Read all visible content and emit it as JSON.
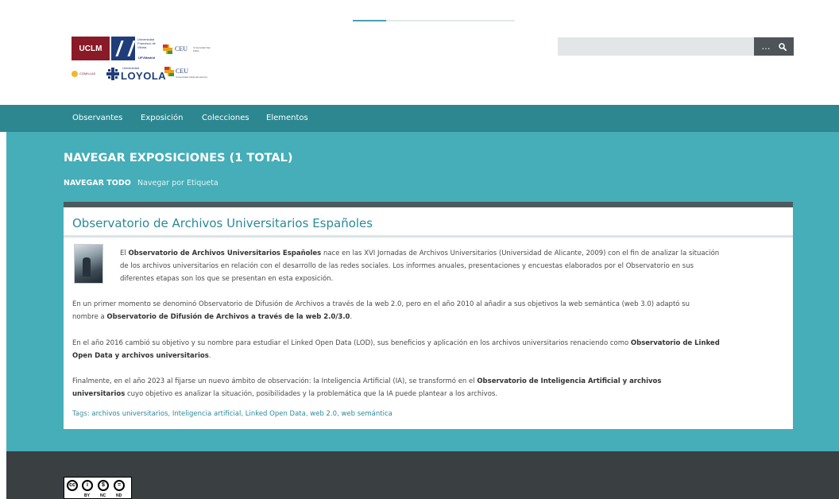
{
  "header": {
    "logos": {
      "uclm": "UCLM",
      "ufv_text": "Universidad Francisco de Vitoria",
      "ufv_madrid": "UFVMadrid",
      "ceu1": "CEU",
      "ceu1_small": "Universidad San Pablo",
      "comillas": "COMILLAS",
      "loyola_small": "Universidad",
      "loyola": "LOYOLA",
      "ceu2": "CEU",
      "ceu2_small": "Universidad Cardenal Herrera"
    },
    "search": {
      "value": "",
      "placeholder": "",
      "advanced_label": "…",
      "submit_icon": "search-icon"
    }
  },
  "nav": {
    "items": [
      "Observantes",
      "Exposición",
      "Colecciones",
      "Elementos"
    ]
  },
  "page": {
    "title": "NAVEGAR EXPOSICIONES (1 TOTAL)",
    "subnav_active": "NAVEGAR TODO",
    "subnav_link": "Navegar por Etiqueta"
  },
  "exhibit": {
    "title": "Observatorio de Archivos Universitarios Españoles",
    "p1": {
      "t1": "El ",
      "b1": "Observatorio de Archivos Universitarios Españoles",
      "t2": " nace en las XVI Jornadas de Archivos Universitarios (Universidad de Alicante, 2009) con el fin de analizar la situación",
      "line2": "de los archivos universitarios en relación con el desarrollo de las redes sociales. Los informes anuales, presentaciones y encuestas elaborados por el Observatorio en sus",
      "line3": "diferentes etapas son los que se presentan en esta exposición."
    },
    "p2": {
      "line1": "En un primer momento se denominó Observatorio de Difusión de Archivos a través de la web 2.0, pero en el año 2010 al añadir a sus objetivos la web semántica (web 3.0) adaptó su",
      "t1": "nombre a ",
      "b1": "Observatorio de Difusión de Archivos a través de la web 2.0/3.0",
      "t2": "."
    },
    "p3": {
      "t1": "En el año 2016 cambió su objetivo y su nombre para estudiar el Linked Open Data (LOD), sus beneficios y aplicación en los archivos universitarios renaciendo como ",
      "b1": "Observatorio de Linked",
      "b2": "Open Data y archivos universitarios",
      "t2": "."
    },
    "p4": {
      "t1": "Finalmente, en el año 2023 al fijarse un nuevo ámbito de observación: la Inteligencia Artificial (IA), se transformó en el ",
      "b1": "Observatorio de Inteligencia Artificial y archivos",
      "b2": "universitarios",
      "t2": " cuyo objetivo es analizar la situación, posibilidades y la problemática que la IA puede plantear a los archivos."
    },
    "tags_label": "Tags: ",
    "tags": [
      "archivos universitarios",
      "Inteligencia artificial",
      "Linked Open Data",
      "web 2.0",
      "web semántica"
    ]
  },
  "footer": {
    "license_icons": [
      "cc",
      "by",
      "nc",
      "nd"
    ],
    "license_labels": [
      "BY",
      "NC",
      "ND"
    ]
  },
  "colors": {
    "nav_bg": "#2c8790",
    "main_bg": "#45aeb8",
    "link": "#2a8a98",
    "footer_bg": "#3a3f42"
  }
}
